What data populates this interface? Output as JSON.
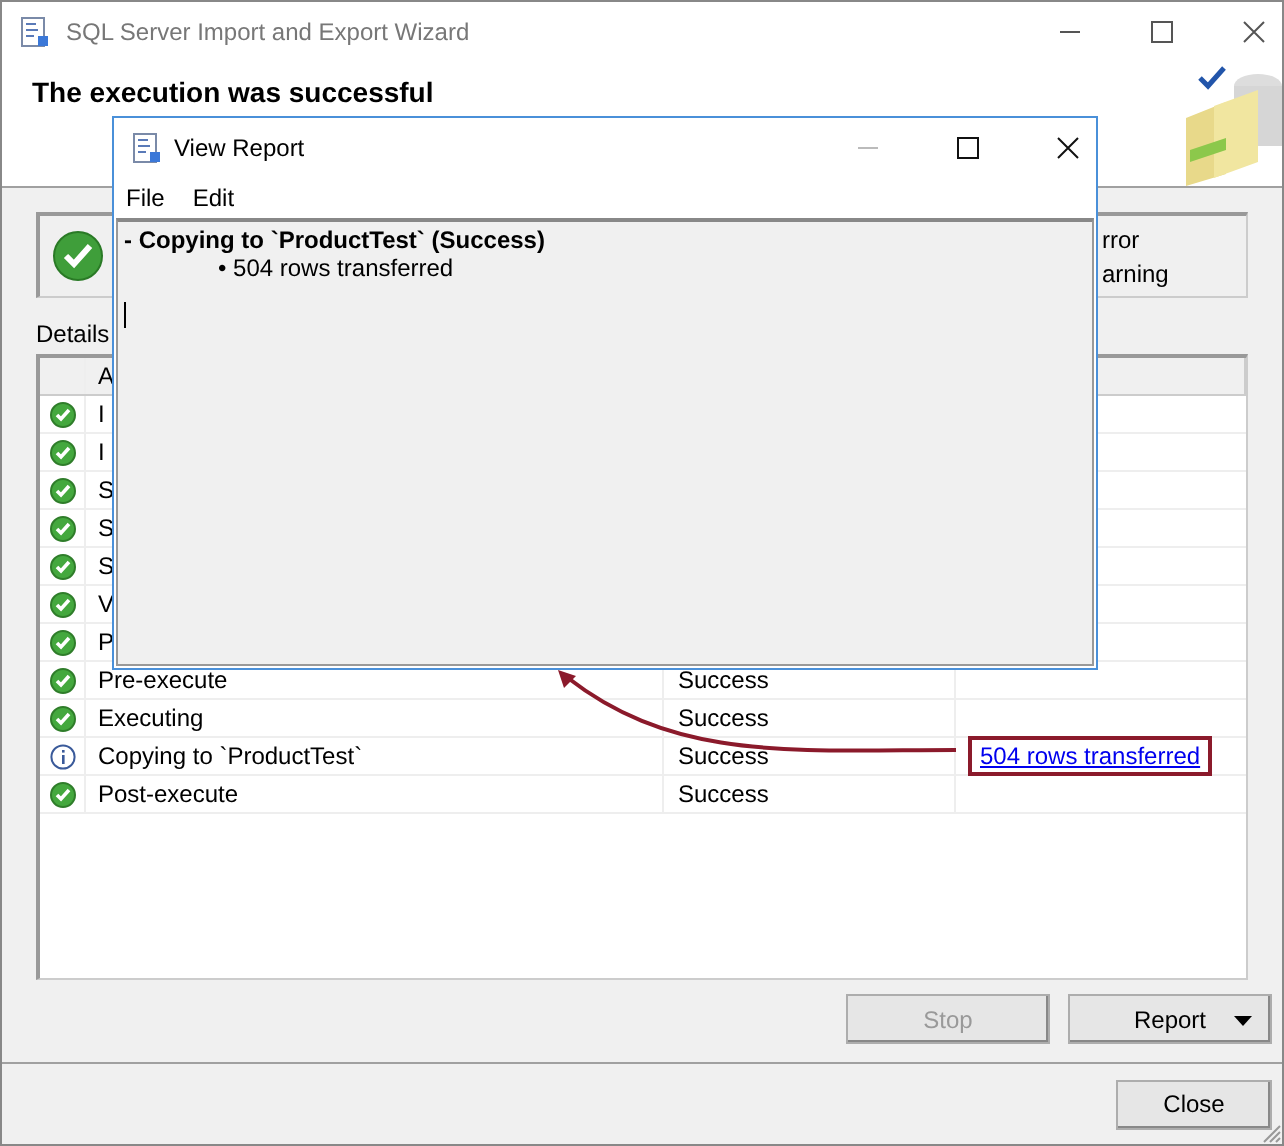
{
  "window": {
    "title": "SQL Server Import and Export Wizard"
  },
  "header": {
    "title": "The execution was successful"
  },
  "summary": {
    "lines": [
      "rror",
      "arning"
    ]
  },
  "details": {
    "label": "Details",
    "columns": [
      "A"
    ],
    "rows": [
      {
        "kind": "success",
        "action": "I"
      },
      {
        "kind": "success",
        "action": "I"
      },
      {
        "kind": "success",
        "action": "S"
      },
      {
        "kind": "success",
        "action": "S"
      },
      {
        "kind": "success",
        "action": "S"
      },
      {
        "kind": "success",
        "action": "V"
      },
      {
        "kind": "success",
        "action": "P"
      },
      {
        "kind": "success",
        "action": "Pre-execute",
        "status": "Success"
      },
      {
        "kind": "success",
        "action": "Executing",
        "status": "Success"
      },
      {
        "kind": "info",
        "action": "Copying to `ProductTest`",
        "status": "Success",
        "message": "504 rows transferred"
      },
      {
        "kind": "success",
        "action": "Post-execute",
        "status": "Success"
      }
    ]
  },
  "buttons": [
    {
      "label": "Stop",
      "disabled": true,
      "kind": "plain"
    },
    {
      "label": "Report",
      "disabled": false,
      "kind": "dropdown"
    }
  ],
  "close_button": {
    "label": "Close"
  },
  "report_window": {
    "title": "View Report",
    "menu": [
      "File",
      "Edit"
    ],
    "heading": "- Copying to `ProductTest` (Success)",
    "bullet": "• 504 rows transferred"
  }
}
